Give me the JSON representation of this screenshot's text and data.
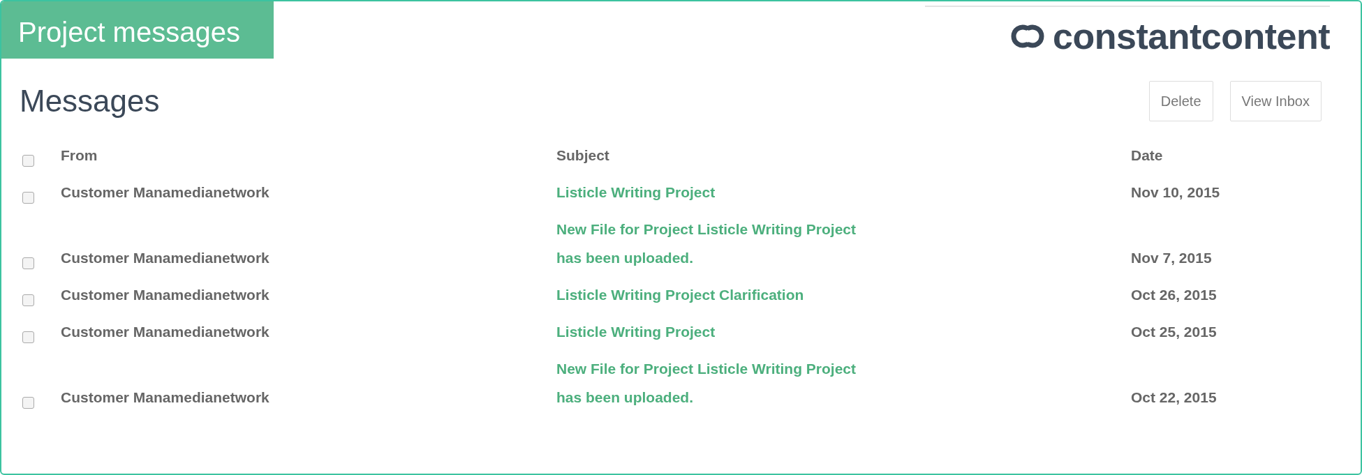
{
  "banner": {
    "title": "Project messages"
  },
  "logo": {
    "text": "constantcontent"
  },
  "heading": "Messages",
  "buttons": [
    "Delete",
    "View Inbox"
  ],
  "table": {
    "select_all": {
      "checked": false
    },
    "columns": [
      "From",
      "Subject",
      "Date"
    ],
    "rows": [
      {
        "checked": false,
        "from": "Customer Manamedianetwork",
        "subject": "Listicle Writing Project",
        "date": "Nov 10, 2015"
      },
      {
        "checked": false,
        "from": "Customer Manamedianetwork",
        "subject": "New File for Project Listicle Writing Project has been uploaded.",
        "date": "Nov 7, 2015"
      },
      {
        "checked": false,
        "from": "Customer Manamedianetwork",
        "subject": "Listicle Writing Project Clarification",
        "date": "Oct 26, 2015"
      },
      {
        "checked": false,
        "from": "Customer Manamedianetwork",
        "subject": "Listicle Writing Project",
        "date": "Oct 25, 2015"
      },
      {
        "checked": false,
        "from": "Customer Manamedianetwork",
        "subject": "New File for Project Listicle Writing Project has been uploaded.",
        "date": "Oct 22, 2015"
      }
    ]
  }
}
